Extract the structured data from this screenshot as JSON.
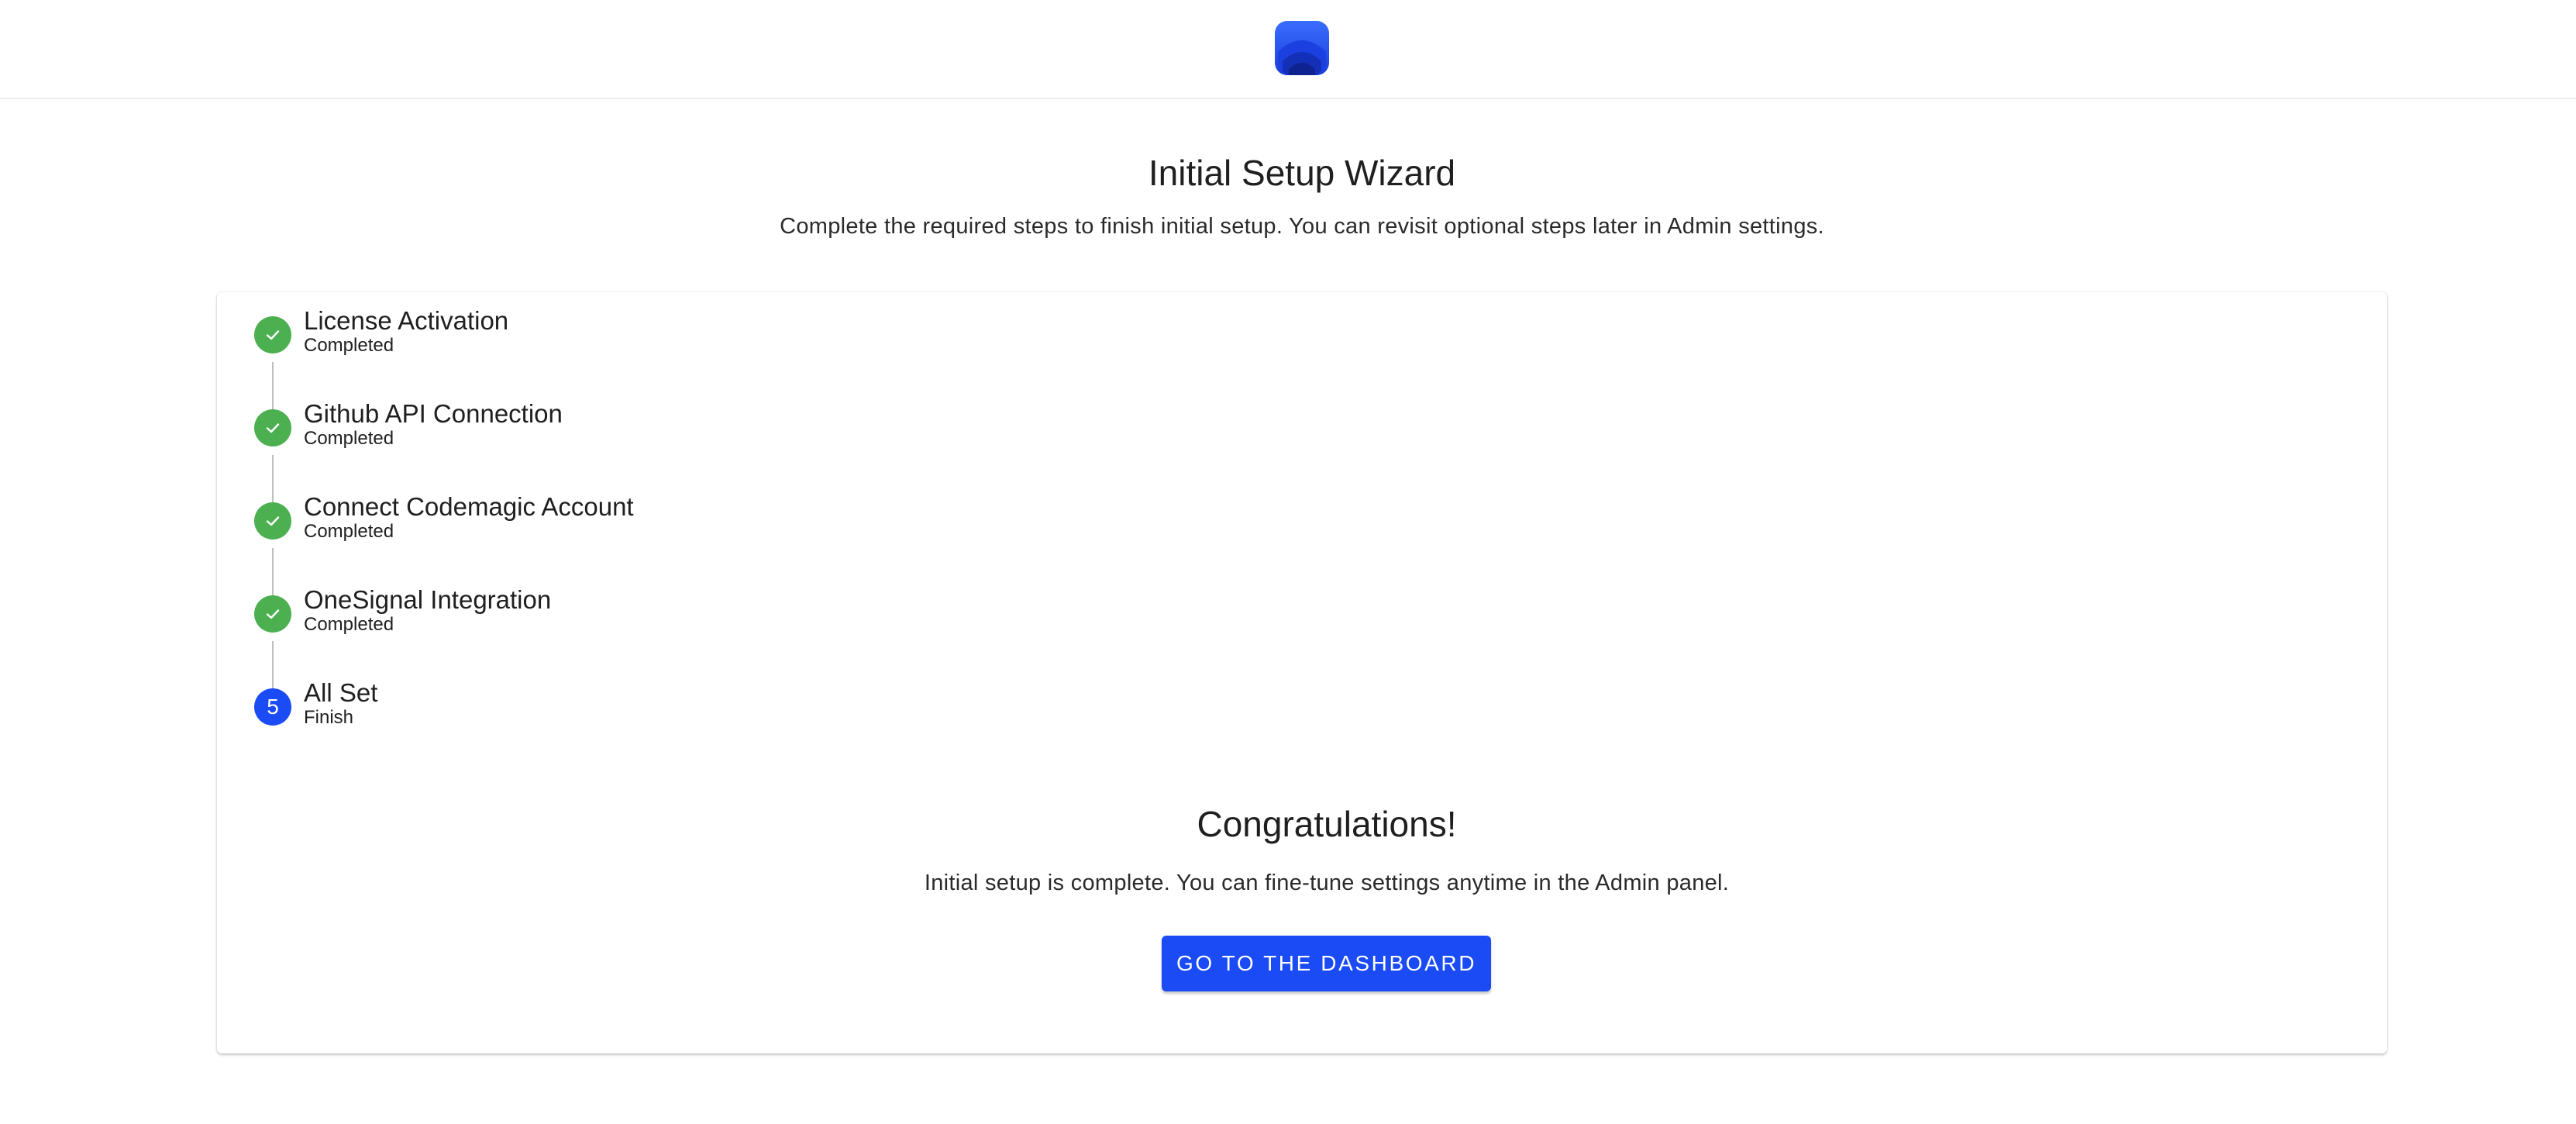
{
  "header": {
    "logo_icon": "app-logo-icon"
  },
  "wizard": {
    "title": "Initial Setup Wizard",
    "subtitle": "Complete the required steps to finish initial setup. You can revisit optional steps later in Admin settings."
  },
  "steps": [
    {
      "label": "License Activation",
      "status": "Completed",
      "state": "done",
      "icon": "check-icon"
    },
    {
      "label": "Github API Connection",
      "status": "Completed",
      "state": "done",
      "icon": "check-icon"
    },
    {
      "label": "Connect Codemagic Account",
      "status": "Completed",
      "state": "done",
      "icon": "check-icon"
    },
    {
      "label": "OneSignal Integration",
      "status": "Completed",
      "state": "done",
      "icon": "check-icon"
    },
    {
      "label": "All Set",
      "status": "Finish",
      "state": "active",
      "number": "5"
    }
  ],
  "completion": {
    "title": "Congratulations!",
    "message": "Initial setup is complete. You can fine-tune settings anytime in the Admin panel.",
    "button_label": "GO TO THE DASHBOARD"
  },
  "colors": {
    "accent": "#1a4bf5",
    "success": "#4caf50",
    "connector": "#bdbdbd"
  }
}
